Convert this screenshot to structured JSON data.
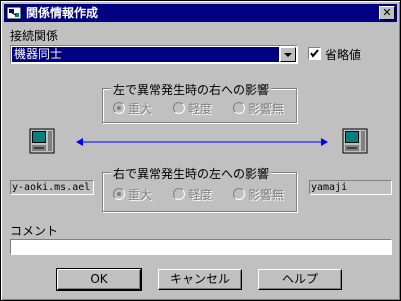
{
  "window": {
    "title": "関係情報作成",
    "close_label": "✕"
  },
  "connection": {
    "label": "接続関係",
    "selected": "機器同士",
    "abbrev_label": "省略値",
    "abbrev_checked": true
  },
  "group_lr": {
    "title": "左で異常発生時の右への影響",
    "options": [
      "重大",
      "軽度",
      "影響無"
    ]
  },
  "group_rl": {
    "title": "右で異常発生時の左への影響",
    "options": [
      "重大",
      "軽度",
      "影響無"
    ]
  },
  "left_host": "y-aoki.ms.ael",
  "right_host": "yamaji",
  "comment": {
    "label": "コメント",
    "value": ""
  },
  "buttons": {
    "ok": "OK",
    "cancel": "キャンセル",
    "help": "ヘルプ"
  },
  "colors": {
    "titlebar": "#000080",
    "arrow": "#0000ff",
    "face": "#c0c0c0"
  }
}
